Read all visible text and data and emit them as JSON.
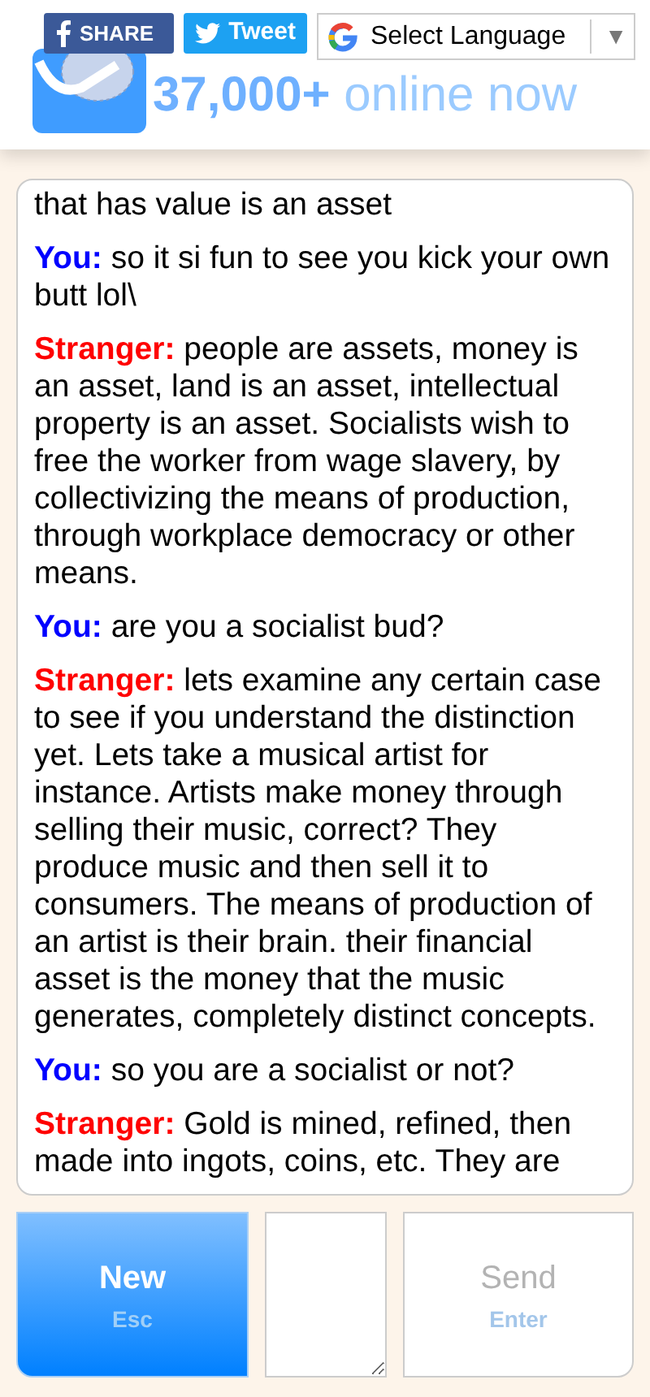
{
  "header": {
    "share_buttons": [
      {
        "kind": "facebook",
        "label": "SHARE"
      },
      {
        "kind": "twitter",
        "label": "Tweet"
      }
    ],
    "language_select": {
      "label": "Select Language",
      "caret": "▼"
    },
    "logo": {
      "kind": "omegle"
    },
    "online_count": {
      "count": "37,000+",
      "label": "online now"
    }
  },
  "chat": {
    "messages": [
      {
        "kind": "continuation",
        "text": "that has value is an asset"
      },
      {
        "kind": "you",
        "speaker": "You:",
        "text": "so it si fun to see you kick your own butt lol\\"
      },
      {
        "kind": "stranger",
        "speaker": "Stranger:",
        "text": "people are assets, money is an asset, land is an asset, intellectual property is an asset. Socialists wish to free the worker from wage slavery, by collectivizing the means of production, through workplace democracy or other means."
      },
      {
        "kind": "you",
        "speaker": "You:",
        "text": "are you a socialist bud?"
      },
      {
        "kind": "stranger",
        "speaker": "Stranger:",
        "text": "lets examine any certain case to see if you understand the distinction yet. Lets take a musical artist for instance. Artists make money through selling their music, correct? They produce music and then sell it to consumers. The means of production of an artist is their brain. their financial asset is the money that the music generates, completely distinct concepts."
      },
      {
        "kind": "you",
        "speaker": "You:",
        "text": "so you are a socialist or not?"
      },
      {
        "kind": "stranger",
        "speaker": "Stranger:",
        "text": "Gold is mined, refined, then made into ingots, coins, etc. They are"
      }
    ]
  },
  "controls": {
    "new_button": {
      "label": "New",
      "hint": "Esc"
    },
    "send_button": {
      "label": "Send",
      "hint": "Enter",
      "disabled": true
    }
  }
}
